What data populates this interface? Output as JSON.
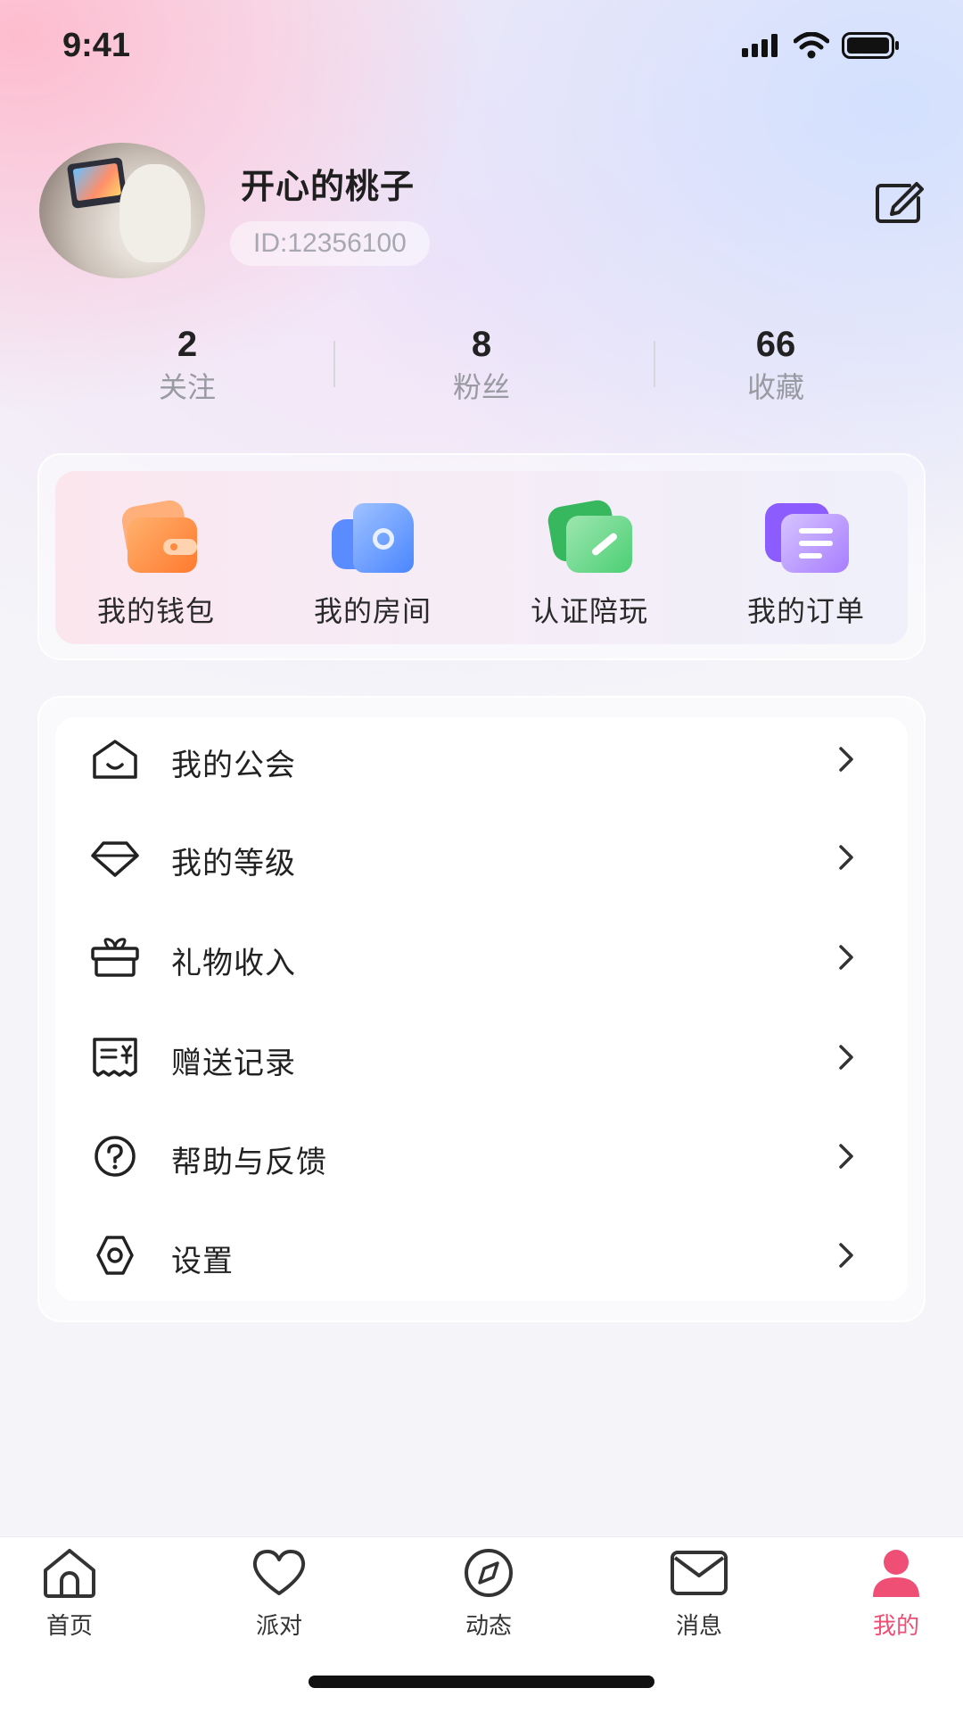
{
  "status_bar": {
    "time": "9:41"
  },
  "profile": {
    "nickname": "开心的桃子",
    "user_id": "ID:12356100"
  },
  "stats": [
    {
      "value": "2",
      "label": "关注"
    },
    {
      "value": "8",
      "label": "粉丝"
    },
    {
      "value": "66",
      "label": "收藏"
    }
  ],
  "quick_actions": [
    {
      "label": "我的钱包",
      "icon": "wallet-icon",
      "color": "#ff8a3d"
    },
    {
      "label": "我的房间",
      "icon": "room-icon",
      "color": "#4a8dff"
    },
    {
      "label": "认证陪玩",
      "icon": "certify-icon",
      "color": "#3fc46a"
    },
    {
      "label": "我的订单",
      "icon": "order-icon",
      "color": "#9b6bff"
    }
  ],
  "menu": [
    {
      "label": "我的公会",
      "icon": "guild-house-icon"
    },
    {
      "label": "我的等级",
      "icon": "diamond-level-icon"
    },
    {
      "label": "礼物收入",
      "icon": "gift-icon"
    },
    {
      "label": "赠送记录",
      "icon": "receipt-icon"
    },
    {
      "label": "帮助与反馈",
      "icon": "help-icon"
    },
    {
      "label": "设置",
      "icon": "settings-gear-icon"
    }
  ],
  "tabs": [
    {
      "label": "首页",
      "icon": "home-icon"
    },
    {
      "label": "派对",
      "icon": "heart-icon"
    },
    {
      "label": "动态",
      "icon": "compass-icon"
    },
    {
      "label": "消息",
      "icon": "mail-icon"
    },
    {
      "label": "我的",
      "icon": "user-icon",
      "active": true
    }
  ],
  "colors": {
    "accent": "#ef4f75"
  }
}
